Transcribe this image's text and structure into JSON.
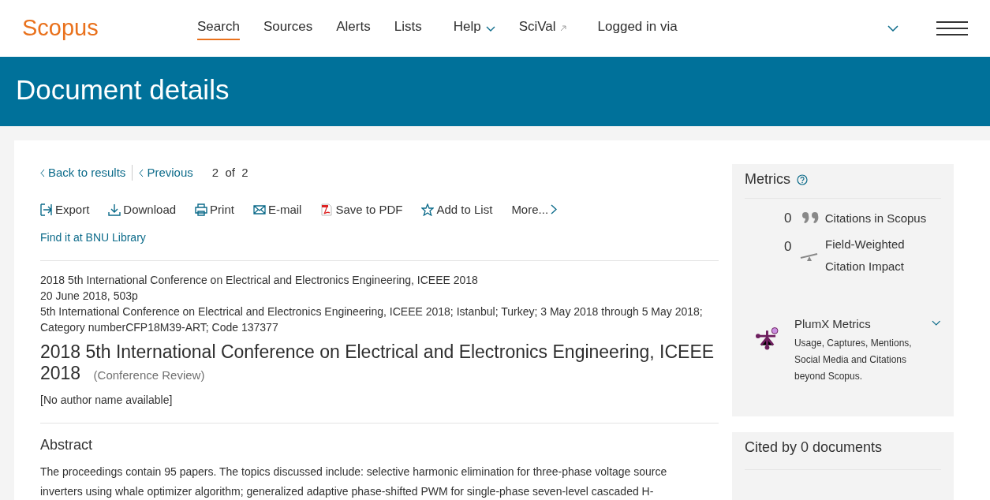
{
  "header": {
    "logo": "Scopus",
    "nav": [
      {
        "label": "Search",
        "kind": "plain",
        "selected": true
      },
      {
        "label": "Sources",
        "kind": "plain",
        "selected": false
      },
      {
        "label": "Alerts",
        "kind": "plain",
        "selected": false
      },
      {
        "label": "Lists",
        "kind": "plain",
        "selected": false
      },
      {
        "label": "Help",
        "kind": "dropdown",
        "selected": false
      },
      {
        "label": "SciVal",
        "kind": "external",
        "selected": false
      },
      {
        "label": "Logged in via",
        "kind": "plain",
        "selected": false
      }
    ]
  },
  "banner": {
    "title": "Document details"
  },
  "pager": {
    "back": "Back to results",
    "previous": "Previous",
    "current": "2",
    "of": "of",
    "total": "2"
  },
  "actions": [
    {
      "label": "Export",
      "kind": "export"
    },
    {
      "label": "Download",
      "kind": "download"
    },
    {
      "label": "Print",
      "kind": "print"
    },
    {
      "label": "E-mail",
      "kind": "email"
    },
    {
      "label": "Save to PDF",
      "kind": "pdf"
    },
    {
      "label": "Add to List",
      "kind": "star"
    },
    {
      "label": "More...",
      "kind": "more"
    }
  ],
  "library_link": "Find it at BNU Library",
  "source": [
    "2018 5th International Conference on Electrical and Electronics Engineering, ICEEE 2018",
    "20 June 2018, 503p",
    "5th International Conference on Electrical and Electronics Engineering, ICEEE 2018; Istanbul; Turkey; 3 May 2018 through 5 May 2018; Category numberCFP18M39-ART; Code 137377"
  ],
  "document": {
    "title": "2018 5th International Conference on Electrical and Electronics Engineering, ICEEE 2018",
    "type": "(Conference Review)",
    "authors": "[No author name available]"
  },
  "abstract": {
    "heading": "Abstract",
    "text": "The proceedings contain 95 papers. The topics discussed include: selective harmonic elimination for three-phase voltage source inverters using whale optimizer algorithm; generalized adaptive phase-shifted PWM for single-phase seven-level cascaded H-"
  },
  "metrics": {
    "heading": "Metrics",
    "items": [
      {
        "value": "0",
        "label": "Citations in Scopus",
        "kind": "quote"
      },
      {
        "value": "0",
        "label": "Field-Weighted Citation Impact",
        "kind": "scale"
      }
    ],
    "plumx": {
      "title": "PlumX Metrics",
      "description": "Usage, Captures, Mentions, Social Media and Citations beyond Scopus."
    }
  },
  "cited_by": {
    "heading": "Cited by 0 documents"
  }
}
